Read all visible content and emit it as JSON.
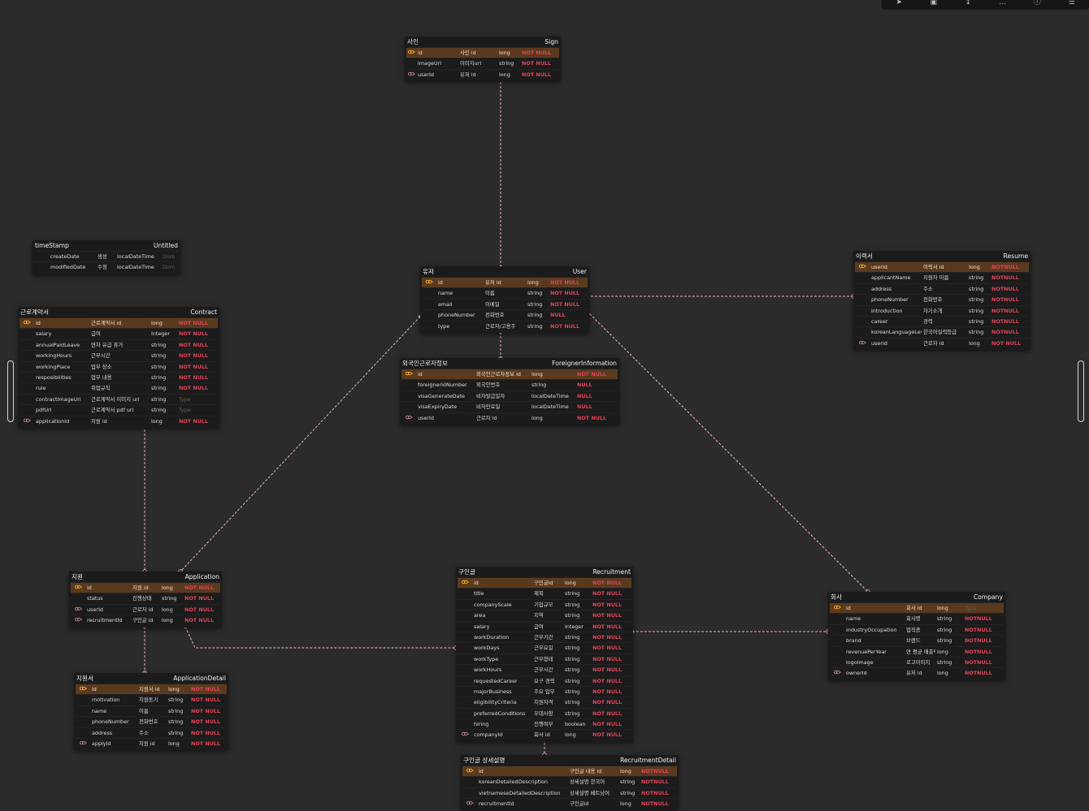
{
  "colors": {
    "background": "#2b2b2b",
    "table_bg": "#1b1b1b",
    "pk_row": "#5a3a1e",
    "not_null": "#e0435a",
    "link": "#e8b4c4",
    "pk_key": "#e8a62a",
    "fk_key": "#b07a86"
  },
  "toolbar": {
    "buttons": [
      {
        "icon": "cursor-icon"
      },
      {
        "icon": "table-add-icon"
      },
      {
        "icon": "arrow-icon"
      },
      {
        "icon": "more-icon"
      },
      {
        "icon": "help-icon"
      },
      {
        "icon": "menu-icon"
      }
    ]
  },
  "tables": [
    {
      "key": "sign",
      "label": "사인",
      "name": "Sign",
      "columns": [
        {
          "key": "pk",
          "field": "id",
          "comment": "사인 id",
          "type": "long",
          "null": "NOT NULL"
        },
        {
          "key": "",
          "field": "imageUrl",
          "comment": "이미지url",
          "type": "string",
          "null": "NOT NULL"
        },
        {
          "key": "fk",
          "field": "userId",
          "comment": "유저 id",
          "type": "long",
          "null": "NOT NULL"
        }
      ]
    },
    {
      "key": "timestamp",
      "label": "timeStamp",
      "name": "Untitled",
      "columns": [
        {
          "key": "",
          "field": "createDate",
          "comment": "생성",
          "type": "localDateTime",
          "null": "Dom"
        },
        {
          "key": "",
          "field": "modifiedDate",
          "comment": "수정",
          "type": "localDateTime",
          "null": "Dom"
        }
      ]
    },
    {
      "key": "user",
      "label": "유저",
      "name": "User",
      "columns": [
        {
          "key": "pk",
          "field": "id",
          "comment": "유저 id",
          "type": "long",
          "null": "NOT NULL"
        },
        {
          "key": "",
          "field": "name",
          "comment": "이름",
          "type": "string",
          "null": "NOT NULL"
        },
        {
          "key": "",
          "field": "email",
          "comment": "이메일",
          "type": "string",
          "null": "NOT NULL"
        },
        {
          "key": "",
          "field": "phoneNumber",
          "comment": "전화번호",
          "type": "string",
          "null": "NULL"
        },
        {
          "key": "",
          "field": "type",
          "comment": "근로자/고용주",
          "type": "string",
          "null": "NOT NULL"
        }
      ]
    },
    {
      "key": "resume",
      "label": "이력서",
      "name": "Resume",
      "columns": [
        {
          "key": "pk",
          "field": "userId",
          "comment": "이력서 id",
          "type": "long",
          "null": "NOTNULL"
        },
        {
          "key": "",
          "field": "applicantName",
          "comment": "지원자 이름",
          "type": "string",
          "null": "NOTNULL"
        },
        {
          "key": "",
          "field": "address",
          "comment": "주소",
          "type": "string",
          "null": "NOTNULL"
        },
        {
          "key": "",
          "field": "phoneNumber",
          "comment": "전화번호",
          "type": "string",
          "null": "NOTNULL"
        },
        {
          "key": "",
          "field": "introduction",
          "comment": "자기소개",
          "type": "string",
          "null": "NOTNULL"
        },
        {
          "key": "",
          "field": "career",
          "comment": "경력",
          "type": "string",
          "null": "NOTNULL"
        },
        {
          "key": "",
          "field": "koreanLanguageLevel",
          "comment": "한국어실력등급",
          "type": "string",
          "null": "NOTNULL"
        },
        {
          "key": "fk",
          "field": "userId",
          "comment": "근로자 id",
          "type": "long",
          "null": "NOT NULL"
        }
      ]
    },
    {
      "key": "contract",
      "label": "근로계약서",
      "name": "Contract",
      "columns": [
        {
          "key": "pk",
          "field": "id",
          "comment": "근로계약서 id",
          "type": "long",
          "null": "NOT NULL"
        },
        {
          "key": "",
          "field": "salary",
          "comment": "급여",
          "type": "Integer",
          "null": "NOT NULL"
        },
        {
          "key": "",
          "field": "annualPaidLeave",
          "comment": "연차 유급 휴가",
          "type": "string",
          "null": "NOT NULL"
        },
        {
          "key": "",
          "field": "workingHours",
          "comment": "근무시간",
          "type": "string",
          "null": "NOT NULL"
        },
        {
          "key": "",
          "field": "workingPlace",
          "comment": "업무 장소",
          "type": "string",
          "null": "NOT NULL"
        },
        {
          "key": "",
          "field": "resposibilities",
          "comment": "업무 내용",
          "type": "string",
          "null": "NOT NULL"
        },
        {
          "key": "",
          "field": "rule",
          "comment": "취업규칙",
          "type": "string",
          "null": "NOT NULL"
        },
        {
          "key": "",
          "field": "contractImageUrl",
          "comment": "근로계약서 이미지 url",
          "type": "string",
          "null": "Type"
        },
        {
          "key": "",
          "field": "pdfUrl",
          "comment": "근로계약서 pdf url",
          "type": "string",
          "null": "Type"
        },
        {
          "key": "fk",
          "field": "applicationId",
          "comment": "지원 id",
          "type": "long",
          "null": "NOT NULL"
        }
      ]
    },
    {
      "key": "foreigner",
      "label": "외국인근로자정보",
      "name": "ForeignerInformation",
      "columns": [
        {
          "key": "pk",
          "field": "id",
          "comment": "외국인근로자정보 id",
          "type": "long",
          "null": "NOT NULL"
        },
        {
          "key": "",
          "field": "foreignerIdNumber",
          "comment": "외국인번호",
          "type": "string",
          "null": "NULL"
        },
        {
          "key": "",
          "field": "visaGenerateDate",
          "comment": "비자발급일자",
          "type": "localDateTime",
          "null": "NULL"
        },
        {
          "key": "",
          "field": "visaExpiryDate",
          "comment": "비자만료일",
          "type": "localDateTime",
          "null": "NULL"
        },
        {
          "key": "fk",
          "field": "userId",
          "comment": "근로자 id",
          "type": "long",
          "null": "NOT NULL"
        }
      ]
    },
    {
      "key": "application",
      "label": "지원",
      "name": "Application",
      "columns": [
        {
          "key": "pk",
          "field": "id",
          "comment": "지원 id",
          "type": "long",
          "null": "NOT NULL"
        },
        {
          "key": "",
          "field": "status",
          "comment": "진행상태",
          "type": "string",
          "null": "NOT NULL"
        },
        {
          "key": "fk",
          "field": "userId",
          "comment": "근로자 id",
          "type": "long",
          "null": "NOT NULL"
        },
        {
          "key": "fk",
          "field": "recruitmentId",
          "comment": "구인글 id",
          "type": "long",
          "null": "NOT NULL"
        }
      ]
    },
    {
      "key": "recruitment",
      "label": "구인글",
      "name": "Recruitment",
      "columns": [
        {
          "key": "pk",
          "field": "id",
          "comment": "구인글id",
          "type": "long",
          "null": "NOT NULL"
        },
        {
          "key": "",
          "field": "title",
          "comment": "제목",
          "type": "string",
          "null": "NOT NULL"
        },
        {
          "key": "",
          "field": "companyScale",
          "comment": "기업규모",
          "type": "string",
          "null": "NOT NULL"
        },
        {
          "key": "",
          "field": "area",
          "comment": "지역",
          "type": "string",
          "null": "NOT NULL"
        },
        {
          "key": "",
          "field": "salary",
          "comment": "급여",
          "type": "Integer",
          "null": "NOT NULL"
        },
        {
          "key": "",
          "field": "workDuration",
          "comment": "근무기간",
          "type": "string",
          "null": "NOT NULL"
        },
        {
          "key": "",
          "field": "workDays",
          "comment": "근무요일",
          "type": "string",
          "null": "NOT NULL"
        },
        {
          "key": "",
          "field": "workType",
          "comment": "근무형태",
          "type": "string",
          "null": "NOT NULL"
        },
        {
          "key": "",
          "field": "workHours",
          "comment": "근무시간",
          "type": "string",
          "null": "NOT NULL"
        },
        {
          "key": "",
          "field": "requestedCareer",
          "comment": "요구 경력",
          "type": "string",
          "null": "NOT NULL"
        },
        {
          "key": "",
          "field": "majorBusiness",
          "comment": "주요 업무",
          "type": "string",
          "null": "NOT NULL"
        },
        {
          "key": "",
          "field": "eligibilityCriteria",
          "comment": "지원자격",
          "type": "string",
          "null": "NOT NULL"
        },
        {
          "key": "",
          "field": "preferredConditions",
          "comment": "우대사항",
          "type": "string",
          "null": "NOT NULL"
        },
        {
          "key": "",
          "field": "hiring",
          "comment": "진행여부",
          "type": "boolean",
          "null": "NOT NULL"
        },
        {
          "key": "fk",
          "field": "companyId",
          "comment": "회사 id",
          "type": "long",
          "null": "NOT NULL"
        }
      ]
    },
    {
      "key": "company",
      "label": "회사",
      "name": "Company",
      "columns": [
        {
          "key": "pk",
          "field": "id",
          "comment": "회사 id",
          "type": "long",
          "null": "Type"
        },
        {
          "key": "",
          "field": "name",
          "comment": "회사명",
          "type": "string",
          "null": "NOTNULL"
        },
        {
          "key": "",
          "field": "industryOccupation",
          "comment": "업직종",
          "type": "string",
          "null": "NOTNULL"
        },
        {
          "key": "",
          "field": "brand",
          "comment": "브랜드",
          "type": "string",
          "null": "NOTNULL"
        },
        {
          "key": "",
          "field": "revenuePerYear",
          "comment": "연 평균 매출액",
          "type": "long",
          "null": "NOTNULL"
        },
        {
          "key": "",
          "field": "logoImage",
          "comment": "로고이미지",
          "type": "string",
          "null": "NOTNULL"
        },
        {
          "key": "fk",
          "field": "ownerId",
          "comment": "유저 id",
          "type": "long",
          "null": "NOTNULL"
        }
      ]
    },
    {
      "key": "appdetail",
      "label": "지원서",
      "name": "ApplicationDetail",
      "columns": [
        {
          "key": "pk",
          "field": "id",
          "comment": "지원서 id",
          "type": "long",
          "null": "NOT NULL"
        },
        {
          "key": "",
          "field": "motivation",
          "comment": "지원동기",
          "type": "string",
          "null": "NOT NULL"
        },
        {
          "key": "",
          "field": "name",
          "comment": "이름",
          "type": "string",
          "null": "NOT NULL"
        },
        {
          "key": "",
          "field": "phoneNumber",
          "comment": "전화번호",
          "type": "string",
          "null": "NOT NULL"
        },
        {
          "key": "",
          "field": "address",
          "comment": "주소",
          "type": "string",
          "null": "NOT NULL"
        },
        {
          "key": "fk",
          "field": "applyId",
          "comment": "지원 id",
          "type": "long",
          "null": "NOT NULL"
        }
      ]
    },
    {
      "key": "recdetail",
      "label": "구인글 상세설명",
      "name": "RecruitmentDetail",
      "columns": [
        {
          "key": "pk",
          "field": "id",
          "comment": "구인글 내용 id",
          "type": "long",
          "null": "NOTNULL"
        },
        {
          "key": "",
          "field": "koreanDetailedDescription",
          "comment": "상세설명 한국어",
          "type": "string",
          "null": "NOTNULL"
        },
        {
          "key": "",
          "field": "vietnameseDetailedDescription",
          "comment": "상세설명 베트남어",
          "type": "string",
          "null": "NOTNULL"
        },
        {
          "key": "fk",
          "field": "recruitmentId",
          "comment": "구인글id",
          "type": "long",
          "null": "NOTNULL"
        }
      ]
    }
  ],
  "relations": [
    {
      "from": "sign",
      "to": "user"
    },
    {
      "from": "user",
      "to": "resume"
    },
    {
      "from": "user",
      "to": "foreigner"
    },
    {
      "from": "user",
      "to": "application"
    },
    {
      "from": "user",
      "to": "company"
    },
    {
      "from": "contract",
      "to": "application"
    },
    {
      "from": "application",
      "to": "appdetail"
    },
    {
      "from": "application",
      "to": "recruitment"
    },
    {
      "from": "recruitment",
      "to": "company"
    },
    {
      "from": "recruitment",
      "to": "recdetail"
    }
  ]
}
